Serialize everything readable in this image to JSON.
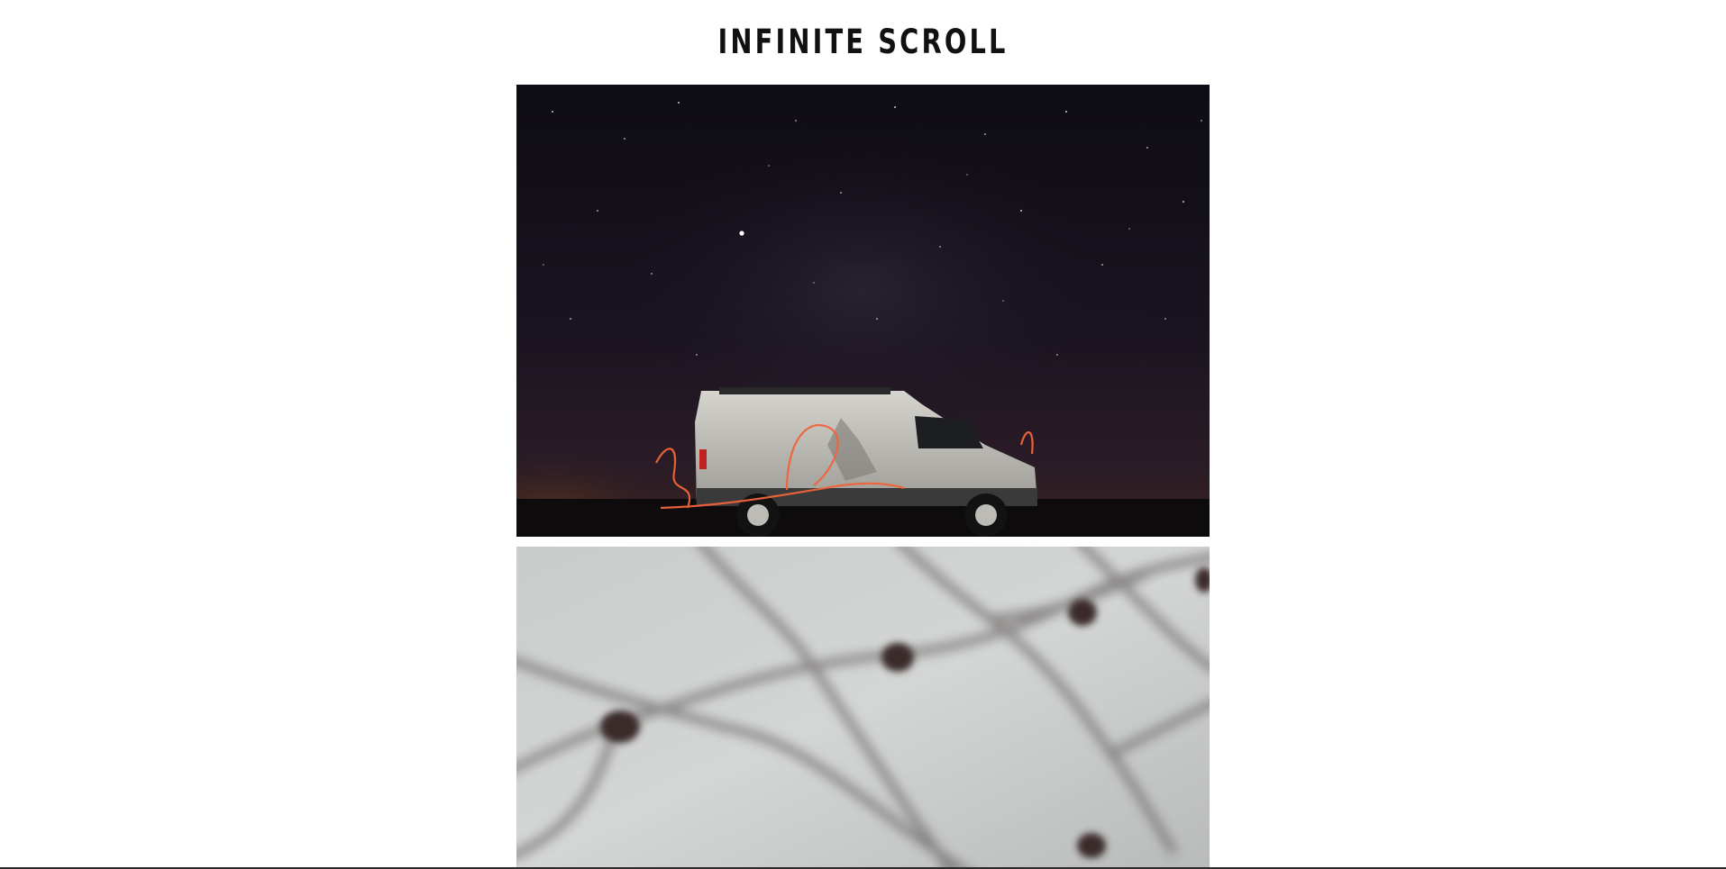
{
  "page": {
    "title": "INFINITE SCROLL"
  },
  "feed": {
    "images": [
      {
        "subject": "night-sky-van-light-painting-photo",
        "colors": {
          "sky": "#120f1a",
          "glow": "#e0502a",
          "van": "#c9c7c2"
        }
      },
      {
        "subject": "blurred-net-mesh-photo",
        "colors": {
          "background": "#cfd2d2",
          "mesh": "#6f6a6a",
          "knot": "#3a2a2c"
        }
      }
    ]
  }
}
